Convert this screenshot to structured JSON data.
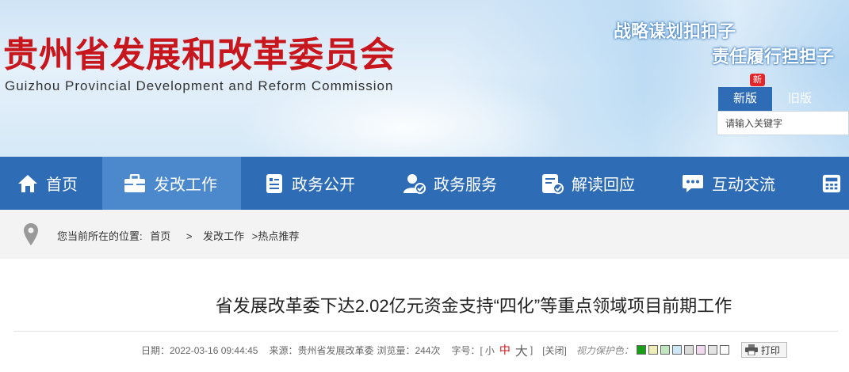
{
  "header": {
    "title_cn": "贵州省发展和改革委员会",
    "title_en": "Guizhou Provincial Development and Reform Commission",
    "slogan_1": "战略谋划扣扣子",
    "slogan_2": "责任履行担担子",
    "new_badge": "新",
    "version_new": "新版",
    "version_old": "旧版",
    "search_placeholder": "请输入关键字"
  },
  "nav": {
    "items": [
      {
        "label": "首页",
        "icon": "home-icon"
      },
      {
        "label": "发改工作",
        "icon": "briefcase-icon",
        "active": true
      },
      {
        "label": "政务公开",
        "icon": "document-icon"
      },
      {
        "label": "政务服务",
        "icon": "user-service-icon"
      },
      {
        "label": "解读回应",
        "icon": "check-document-icon"
      },
      {
        "label": "互动交流",
        "icon": "chat-icon"
      },
      {
        "label": "",
        "icon": "calculator-icon"
      }
    ]
  },
  "breadcrumb": {
    "prefix": "您当前所在的位置:",
    "items": [
      "首页",
      "发改工作",
      ">热点推荐"
    ],
    "separator": ">"
  },
  "article": {
    "title": "省发展改革委下达2.02亿元资金支持“四化”等重点领域项目前期工作",
    "date": "日期：2022-03-16 09:44:45",
    "source": "来源：贵州省发展改革委",
    "views": "浏览量：244次",
    "font_label": "字号：[",
    "font_small": "小",
    "font_medium": "中",
    "font_large": "大",
    "font_close": "]",
    "close_label": "[关闭]",
    "eye_protect_label": "视力保护色：",
    "eye_colors": [
      "#1a9e1a",
      "#eeeebb",
      "#bfe6bf",
      "#cce8f8",
      "#dcdcdc",
      "#f0d8f0",
      "#e4e4e4",
      "#ffffff"
    ],
    "print_label": "打印"
  },
  "colors": {
    "nav_bg": "#2f6cb6",
    "nav_active": "#4b88cc",
    "brand_red": "#c8161d"
  }
}
